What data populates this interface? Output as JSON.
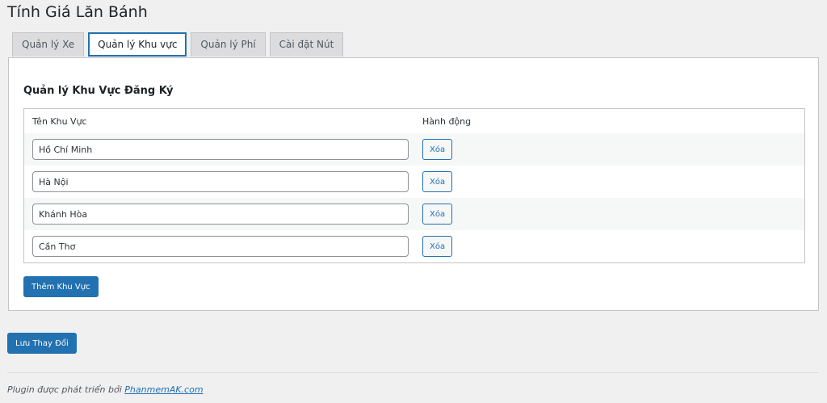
{
  "page": {
    "title": "Tính Giá Lăn Bánh"
  },
  "tabs": [
    {
      "label": "Quản lý Xe"
    },
    {
      "label": "Quản lý Khu vực"
    },
    {
      "label": "Quản lý Phí"
    },
    {
      "label": "Cài đặt Nút"
    }
  ],
  "active_tab": "Quản lý Khu vực",
  "section": {
    "title": "Quản lý Khu Vực Đăng Ký",
    "columns": {
      "name": "Tên Khu Vực",
      "action": "Hành động"
    },
    "rows": [
      {
        "name": "Hồ Chí Minh",
        "action": "Xóa"
      },
      {
        "name": "Hà Nội",
        "action": "Xóa"
      },
      {
        "name": "Khánh Hòa",
        "action": "Xóa"
      },
      {
        "name": "Cần Thơ",
        "action": "Xóa"
      }
    ],
    "add_label": "Thêm Khu Vực"
  },
  "save_label": "Lưu Thay Đổi",
  "footer": {
    "text": "Plugin được phát triển bởi",
    "link_text": "PhanmemAK.com"
  },
  "colors": {
    "accent": "#2271b1",
    "background": "#f0f0f1",
    "panel": "#ffffff"
  }
}
